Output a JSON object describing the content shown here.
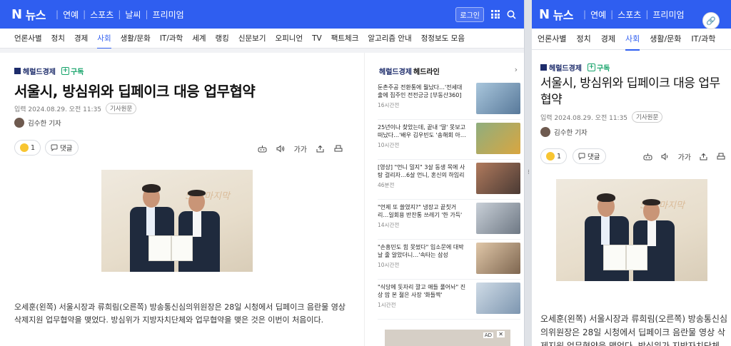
{
  "brand": {
    "logo_letter": "N",
    "logo_text": "뉴스",
    "accent": "#2f5ef0"
  },
  "top_nav": [
    "연예",
    "스포츠",
    "날씨",
    "프리미엄"
  ],
  "login_label": "로그인",
  "sections": [
    "언론사별",
    "정치",
    "경제",
    "사회",
    "생활/문화",
    "IT/과학",
    "세계",
    "랭킹",
    "신문보기",
    "오피니언",
    "TV",
    "팩트체크",
    "알고리즘 안내",
    "정정보도 모음"
  ],
  "sections_right": [
    "언론사별",
    "정치",
    "경제",
    "사회",
    "생활/문화",
    "IT/과학"
  ],
  "active_section": "사회",
  "article": {
    "press": "헤럴드경제",
    "subscribe": "구독",
    "title": "서울시, 방심위와 딥페이크 대응 업무협약",
    "date": "입력 2024.08.29. 오전 11:35",
    "original_label": "기사원문",
    "reporter": "김수한 기자",
    "reaction_count": "1",
    "comment_label": "댓글",
    "font_label": "가가",
    "photo_wall_text": "5th 마지막",
    "caption": "오세훈(왼쪽) 서울시장과 류희림(오른쪽) 방송통신심의위원장은 28일 시청에서 딥페이크 음란물 영상 삭제지원 업무협약을 맺었다. 방심위가 지방자치단체와 업무협약을 맺은 것은 이번이 처음이다.",
    "caption_right": "오세훈(왼쪽) 서울시장과 류희림(오른쪽) 방송통신심의위원장은 28일 시청에서 딥페이크 음란물 영상 삭제지원 업무협약을 맺었다. 방심위가 지방자치단체"
  },
  "sidebar": {
    "press": "헤럴드경제",
    "title": "헤드라인",
    "items": [
      {
        "title": "둔촌주공 전환통에 뭘났다…'전세대출에 집주인 전전긍긍 [부동산360]",
        "ago": "16시간전",
        "thumb": "#7fa0b8"
      },
      {
        "title": "25년이나 찾았는데, 끝내 '딸' 못보고 떠났다…'배우 김우빈도 '송해회 아…",
        "ago": "10시간전",
        "thumb": "#6d8a64"
      },
      {
        "title": "[영상] \"언니 밀지\" 3살 동생 목에 사탕 걸리자…6살 언니, 혼신의 하임리히법",
        "ago": "46분전",
        "thumb": "#9a6f5b"
      },
      {
        "title": "\"언제 또 쓸였지?\" 냉장고 끝칫거리…일회용 반찬통 쓰레기 '한 가득' [지…",
        "ago": "14시간전",
        "thumb": "#8e97a3"
      },
      {
        "title": "\"손흥민도 힘 못썼다\" 입소문에 대박날 줄 알았더니…'속타는 삼성",
        "ago": "10시간전",
        "thumb": "#b5a08a"
      },
      {
        "title": "\"식당에 돗자리 깔고 애들 풀어놔\" 진상 맘 본 젊은 사장 '화들짝'",
        "ago": "1시간전",
        "thumb": "#a9b9c7"
      }
    ],
    "ad_label": "AD",
    "ad_close": "✕"
  }
}
